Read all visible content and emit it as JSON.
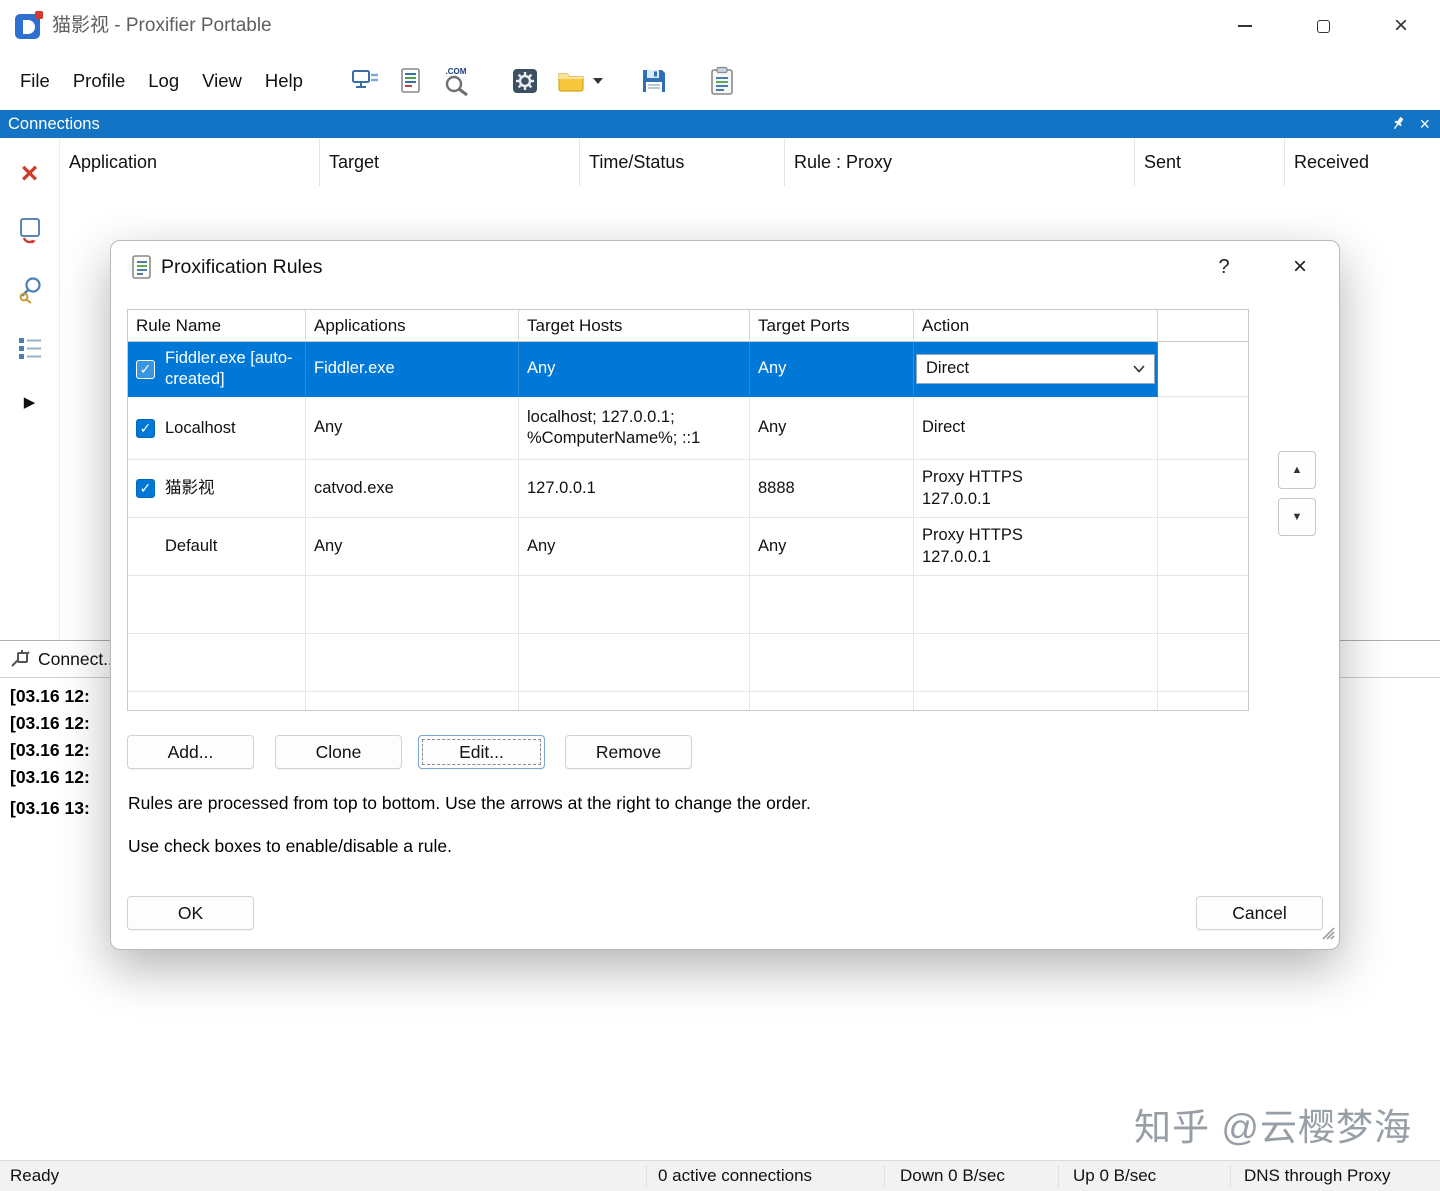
{
  "window": {
    "title": "猫影视 - Proxifier Portable"
  },
  "menu": {
    "items": [
      "File",
      "Profile",
      "Log",
      "View",
      "Help"
    ]
  },
  "toolbar": {
    "icons": [
      "network-connections",
      "report-log",
      "search-com",
      "settings-gear",
      "open-profile-folder",
      "save-profile",
      "proxy-checker"
    ]
  },
  "connections_panel": {
    "title": "Connections",
    "columns": [
      "Application",
      "Target",
      "Time/Status",
      "Rule : Proxy",
      "Sent",
      "Received"
    ]
  },
  "output_panel": {
    "tab_label": "Connect...",
    "log_lines": [
      "[03.16 12:",
      "[03.16 12:",
      "[03.16 12:",
      "[03.16 12:",
      "[03.16 13:"
    ]
  },
  "dialog": {
    "title": "Proxification Rules",
    "help_button": "?",
    "table": {
      "columns": [
        "Rule Name",
        "Applications",
        "Target Hosts",
        "Target Ports",
        "Action"
      ],
      "rows": [
        {
          "enabled": true,
          "selected": true,
          "name": "Fiddler.exe [auto-created]",
          "applications": "Fiddler.exe",
          "target_hosts": "Any",
          "target_ports": "Any",
          "action": "Direct",
          "action_is_dropdown": true
        },
        {
          "enabled": true,
          "selected": false,
          "name": "Localhost",
          "applications": "Any",
          "target_hosts": "localhost; 127.0.0.1; %ComputerName%; ::1",
          "target_ports": "Any",
          "action": "Direct",
          "action_is_dropdown": false
        },
        {
          "enabled": true,
          "selected": false,
          "name": "猫影视",
          "applications": "catvod.exe",
          "target_hosts": "127.0.0.1",
          "target_ports": "8888",
          "action": "Proxy HTTPS 127.0.0.1",
          "action_is_dropdown": false
        },
        {
          "enabled": false,
          "selected": false,
          "name": "Default",
          "applications": "Any",
          "target_hosts": "Any",
          "target_ports": "Any",
          "action": "Proxy HTTPS 127.0.0.1",
          "action_is_dropdown": false
        }
      ]
    },
    "buttons": {
      "add": "Add...",
      "clone": "Clone",
      "edit": "Edit...",
      "remove": "Remove",
      "ok": "OK",
      "cancel": "Cancel"
    },
    "hint1": "Rules are processed from top to bottom. Use the arrows at the right to change the order.",
    "hint2": "Use check boxes to enable/disable a rule."
  },
  "status_bar": {
    "state": "Ready",
    "active_connections": "0 active connections",
    "down": "Down 0 B/sec",
    "up": "Up 0 B/sec",
    "dns": "DNS through Proxy"
  },
  "watermark": "知乎 @云樱梦海",
  "icons": {
    "close": "×",
    "help": "?",
    "checkmark": "✓",
    "up_arrow": "▲",
    "down_arrow": "▼",
    "play_arrow": "▶",
    "clear_cross": "×"
  },
  "colors": {
    "selection": "#0078d7",
    "panel_caption": "#1373c4",
    "checkbox": "#0078d7"
  }
}
